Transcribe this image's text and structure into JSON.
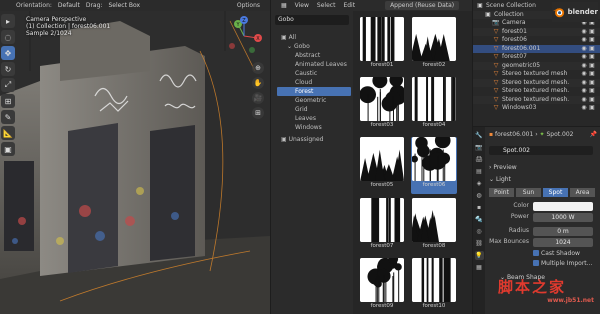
{
  "viewport": {
    "header": {
      "orientation_label": "Orientation:",
      "orientation_value": "Default",
      "drag_label": "Drag:",
      "drag_value": "Select Box",
      "options_label": "Options"
    },
    "overlay": {
      "line1": "Camera Perspective",
      "line2": "(1) Collection | forest06.001",
      "line3": "Sample 2/1024"
    },
    "gizmo": {
      "x": "X",
      "y": "Y",
      "z": "Z"
    },
    "tools": [
      "cursor-icon",
      "select-icon",
      "move-icon",
      "rotate-icon",
      "scale-icon",
      "transform-icon",
      "annotate-icon",
      "measure-icon",
      "add-cube-icon"
    ]
  },
  "browser": {
    "menu": [
      "View",
      "Select",
      "Edit"
    ],
    "import_mode": "Append (Reuse Data)",
    "library": "Gobo",
    "categories": [
      {
        "label": "All",
        "level": 0,
        "selected": false
      },
      {
        "label": "Gobo",
        "level": 1,
        "selected": false
      },
      {
        "label": "Abstract",
        "level": 2,
        "selected": false
      },
      {
        "label": "Animated Leaves",
        "level": 2,
        "selected": false
      },
      {
        "label": "Caustic",
        "level": 2,
        "selected": false
      },
      {
        "label": "Cloud",
        "level": 2,
        "selected": false
      },
      {
        "label": "Forest",
        "level": 2,
        "selected": true
      },
      {
        "label": "Geometric",
        "level": 2,
        "selected": false
      },
      {
        "label": "Grid",
        "level": 2,
        "selected": false
      },
      {
        "label": "Leaves",
        "level": 2,
        "selected": false
      },
      {
        "label": "Windows",
        "level": 2,
        "selected": false
      },
      {
        "label": "Unassigned",
        "level": 0,
        "selected": false
      }
    ],
    "assets": [
      {
        "name": "forest01",
        "selected": false
      },
      {
        "name": "forest02",
        "selected": false
      },
      {
        "name": "forest03",
        "selected": false
      },
      {
        "name": "forest04",
        "selected": false
      },
      {
        "name": "forest05",
        "selected": false
      },
      {
        "name": "forest06",
        "selected": true
      },
      {
        "name": "forest07",
        "selected": false
      },
      {
        "name": "forest08",
        "selected": false
      },
      {
        "name": "forest09",
        "selected": false
      },
      {
        "name": "forest10",
        "selected": false
      }
    ]
  },
  "outliner": {
    "rows": [
      {
        "label": "Scene Collection",
        "icon": "collection-icon",
        "indent": 0,
        "color": "#d8d8d8",
        "selected": false
      },
      {
        "label": "Collection",
        "icon": "collection-icon",
        "indent": 1,
        "color": "#d8d8d8",
        "selected": false
      },
      {
        "label": "Camera",
        "icon": "camera-icon",
        "indent": 2,
        "color": "#f08a3a",
        "selected": false
      },
      {
        "label": "forest01",
        "icon": "object-icon",
        "indent": 2,
        "color": "#f08a3a",
        "selected": false
      },
      {
        "label": "forest06",
        "icon": "object-icon",
        "indent": 2,
        "color": "#f08a3a",
        "selected": false
      },
      {
        "label": "forest06.001",
        "icon": "object-icon",
        "indent": 2,
        "color": "#f08a3a",
        "selected": true
      },
      {
        "label": "forest07",
        "icon": "object-icon",
        "indent": 2,
        "color": "#f08a3a",
        "selected": false
      },
      {
        "label": "geometric05",
        "icon": "object-icon",
        "indent": 2,
        "color": "#f08a3a",
        "selected": false
      },
      {
        "label": "Stereo textured mesh",
        "icon": "mesh-icon",
        "indent": 2,
        "color": "#f08a3a",
        "selected": false
      },
      {
        "label": "Stereo textured mesh.",
        "icon": "mesh-icon",
        "indent": 2,
        "color": "#f08a3a",
        "selected": false
      },
      {
        "label": "Stereo textured mesh.",
        "icon": "mesh-icon",
        "indent": 2,
        "color": "#f08a3a",
        "selected": false
      },
      {
        "label": "Stereo textured mesh.",
        "icon": "mesh-icon",
        "indent": 2,
        "color": "#f08a3a",
        "selected": false
      },
      {
        "label": "Windows03",
        "icon": "object-icon",
        "indent": 2,
        "color": "#f08a3a",
        "selected": false
      }
    ]
  },
  "properties": {
    "object_name": "forest06.001",
    "data_name": "Spot.002",
    "datablock": "Spot.002",
    "preview_label": "Preview",
    "light_label": "Light",
    "light_types": [
      {
        "label": "Point",
        "active": false
      },
      {
        "label": "Sun",
        "active": false
      },
      {
        "label": "Spot",
        "active": true
      },
      {
        "label": "Area",
        "active": false
      }
    ],
    "color_label": "Color",
    "power_label": "Power",
    "power_value": "1000 W",
    "radius_label": "Radius",
    "radius_value": "0 m",
    "max_bounces_label": "Max Bounces",
    "max_bounces_value": "1024",
    "cast_shadow_label": "Cast Shadow",
    "multiple_importance_label": "Multiple Import...",
    "beam_shape_label": "Beam Shape",
    "accent_color": "#4772b3"
  },
  "watermark": {
    "main": "脚本之家",
    "sub": "www.jb51.net"
  }
}
